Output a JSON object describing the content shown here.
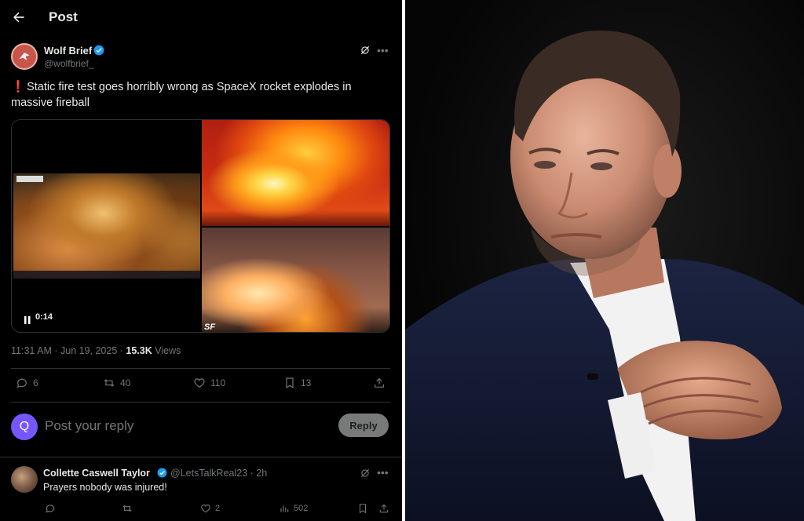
{
  "header": {
    "title": "Post"
  },
  "post": {
    "author_name": "Wolf Brief",
    "author_handle": "@wolfbrief_",
    "text_emoji": "❗",
    "text": "Static fire test goes horribly wrong as SpaceX rocket explodes in massive fireball",
    "video_time": "0:14",
    "image_watermark": "SF",
    "timestamp": "11:31 AM · Jun 19, 2025 · ",
    "views_count": "15.3K",
    "views_label": " Views",
    "stats": {
      "replies": "6",
      "reposts": "40",
      "likes": "110",
      "bookmarks": "13"
    }
  },
  "reply_box": {
    "avatar_letter": "Q",
    "placeholder": "Post your reply",
    "button_label": "Reply"
  },
  "comment": {
    "name": "Collette Caswell Taylor",
    "handle": "@LetsTalkReal23 · 2h",
    "text": "Prayers nobody was injured!",
    "stats": {
      "replies": "",
      "reposts": "",
      "likes": "2",
      "views": "502"
    }
  },
  "colors": {
    "background": "#000000",
    "text": "#e7e9ea",
    "muted": "#71767b",
    "verified": "#1d9bf0",
    "accent": "#7856ff"
  }
}
